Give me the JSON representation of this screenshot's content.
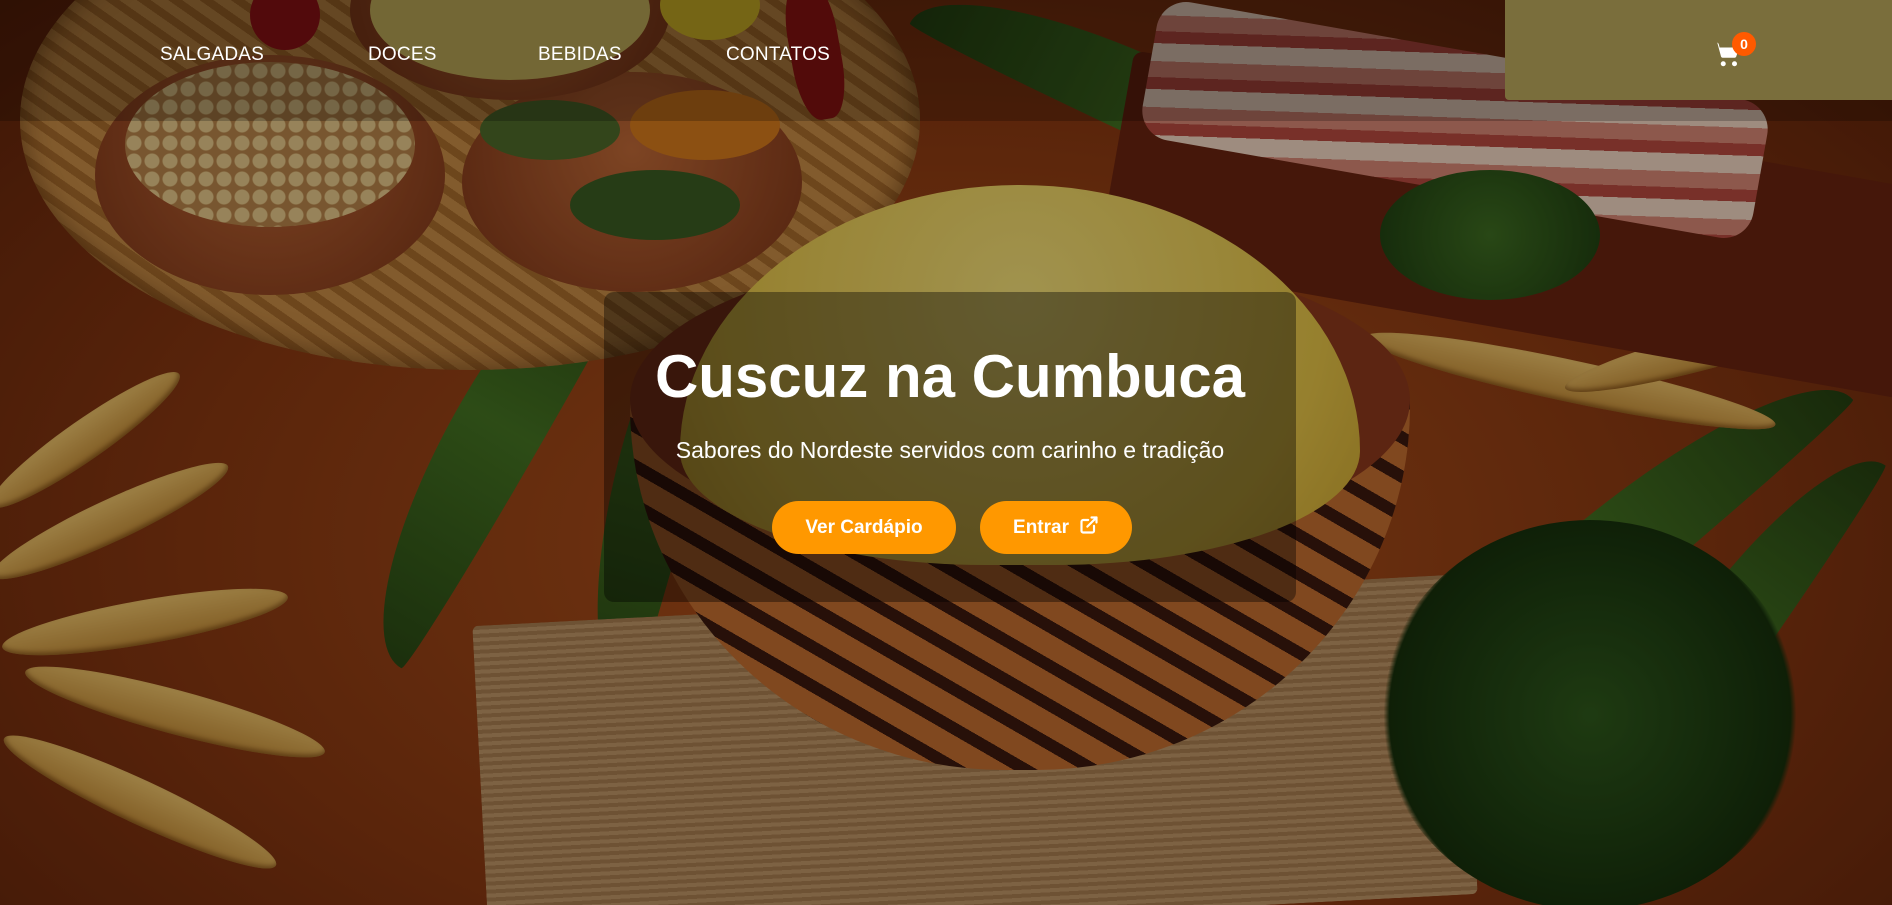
{
  "nav": {
    "items": [
      {
        "label": "SALGADAS"
      },
      {
        "label": "DOCES"
      },
      {
        "label": "BEBIDAS"
      },
      {
        "label": "CONTATOS"
      }
    ],
    "cart": {
      "icon": "cart-icon",
      "count": "0"
    }
  },
  "hero": {
    "title": "Cuscuz na Cumbuca",
    "subtitle": "Sabores do Nordeste servidos com carinho e tradição",
    "menu_button": "Ver Cardápio",
    "login_button": "Entrar",
    "login_icon": "external-link-icon"
  },
  "colors": {
    "accent": "#ff9800",
    "badge": "#ff5a00",
    "text": "#ffffff"
  }
}
